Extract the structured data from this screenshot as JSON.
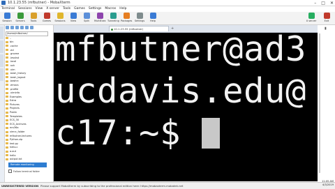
{
  "window": {
    "title": "10.1.23.55 (mfbutner) - MobaXterm",
    "controls": [
      "–",
      "□",
      "✕"
    ]
  },
  "menu": [
    "Terminal",
    "Sessions",
    "View",
    "X server",
    "Tools",
    "Games",
    "Settings",
    "Macros",
    "Help"
  ],
  "toolbar": {
    "left": [
      {
        "label": "Session",
        "icon": "monitor-icon",
        "color": "#3a7bd5"
      },
      {
        "label": "Servers",
        "icon": "server-icon",
        "color": "#3b9a3b"
      },
      {
        "label": "Tools",
        "icon": "tools-icon",
        "color": "#d9a02b"
      },
      {
        "label": "Games",
        "icon": "games-icon",
        "color": "#c0392b"
      },
      {
        "label": "Sessions",
        "icon": "star-icon",
        "color": "#e0b62c"
      },
      {
        "label": "View",
        "icon": "view-icon",
        "color": "#3a7bd5"
      },
      {
        "label": "Split",
        "icon": "split-icon",
        "color": "#5b8fd9"
      },
      {
        "label": "MultiExec",
        "icon": "multiexec-icon",
        "color": "#8e44ad"
      },
      {
        "label": "Tunneling",
        "icon": "tunnel-icon",
        "color": "#2a9d8f"
      },
      {
        "label": "Packages",
        "icon": "packages-icon",
        "color": "#e67e22"
      },
      {
        "label": "Settings",
        "icon": "gear-icon",
        "color": "#7f8c8d"
      },
      {
        "label": "Help",
        "icon": "help-icon",
        "color": "#3a7bd5"
      }
    ],
    "right": [
      {
        "label": "X server",
        "icon": "xserver-icon",
        "color": "#27ae60"
      },
      {
        "label": "Exit",
        "icon": "exit-icon",
        "color": "#c0392b"
      }
    ]
  },
  "sidebar": {
    "path": "/home/mfbutner/",
    "items": [
      "..",
      "bin",
      ".cache",
      ".ecl",
      ".gnome",
      ".lesshst",
      ".local",
      ".ssh",
      ".vim",
      ".bash_history",
      ".bash_logout",
      ".bashrc",
      ".emacs",
      ".profile",
      ".viminfo",
      "Examples",
      "Extra",
      "Pictures",
      "Projects",
      "Public",
      "Templates",
      "ECS_30",
      "ECS_Archives",
      "ecs36a",
      "vimrc_folder",
      "mfbutner-lectures",
      "Python.zip",
      "test.py",
      "hello.c",
      "a.out",
      "hello",
      "output.txt"
    ],
    "monitor_label": "Remote monitoring",
    "follow_label": "Follow terminal folder"
  },
  "tabs": [
    {
      "label": "10.1.23.55 (mfbutner)"
    }
  ],
  "terminal": {
    "lines": [
      "mfbutner@ad3",
      "ucdavis.edu@",
      "c17:~$ "
    ]
  },
  "status": {
    "unregistered": "UNREGISTERED VERSION",
    "message": "Please support MobaXterm by subscribing to the professional edition here: https://mobaxterm.mobatek.net"
  },
  "clock": {
    "time": "11:05 AM",
    "date": "4/3/2019"
  }
}
